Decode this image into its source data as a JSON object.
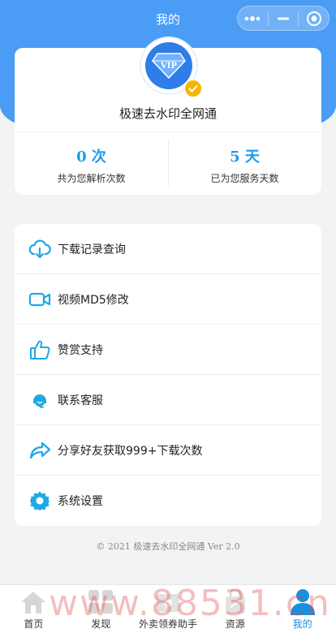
{
  "nav": {
    "title": "我的"
  },
  "profile": {
    "badge_text": "VIP",
    "app_name": "极速去水印全网通",
    "stats": [
      {
        "value": "0 次",
        "label": "共为您解析次数"
      },
      {
        "value": "5 天",
        "label": "已为您服务天数"
      }
    ]
  },
  "menu": {
    "items": [
      {
        "label": "下载记录查询",
        "icon": "cloud-download-icon"
      },
      {
        "label": "视频MD5修改",
        "icon": "video-camera-icon"
      },
      {
        "label": "赞赏支持",
        "icon": "thumbs-up-icon"
      },
      {
        "label": "联系客服",
        "icon": "customer-service-icon"
      },
      {
        "label": "分享好友获取999+下载次数",
        "icon": "share-arrow-icon"
      },
      {
        "label": "系统设置",
        "icon": "gear-icon"
      }
    ]
  },
  "footer": {
    "copyright": "© 2021 极速去水印全网通 Ver 2.0"
  },
  "tabbar": {
    "tabs": [
      {
        "label": "首页",
        "icon": "home-icon"
      },
      {
        "label": "发现",
        "icon": "discover-grid-icon"
      },
      {
        "label": "外卖领券助手",
        "icon": "coupon-icon"
      },
      {
        "label": "资源",
        "icon": "resource-bag-icon"
      },
      {
        "label": "我的",
        "icon": "user-icon",
        "active": true
      }
    ]
  },
  "watermark": {
    "text": "www.88531.cn"
  },
  "colors": {
    "primary": "#4a9cf5",
    "accent": "#1a9ce8",
    "icon": "#1fa8e6",
    "verify": "#f5b800"
  }
}
